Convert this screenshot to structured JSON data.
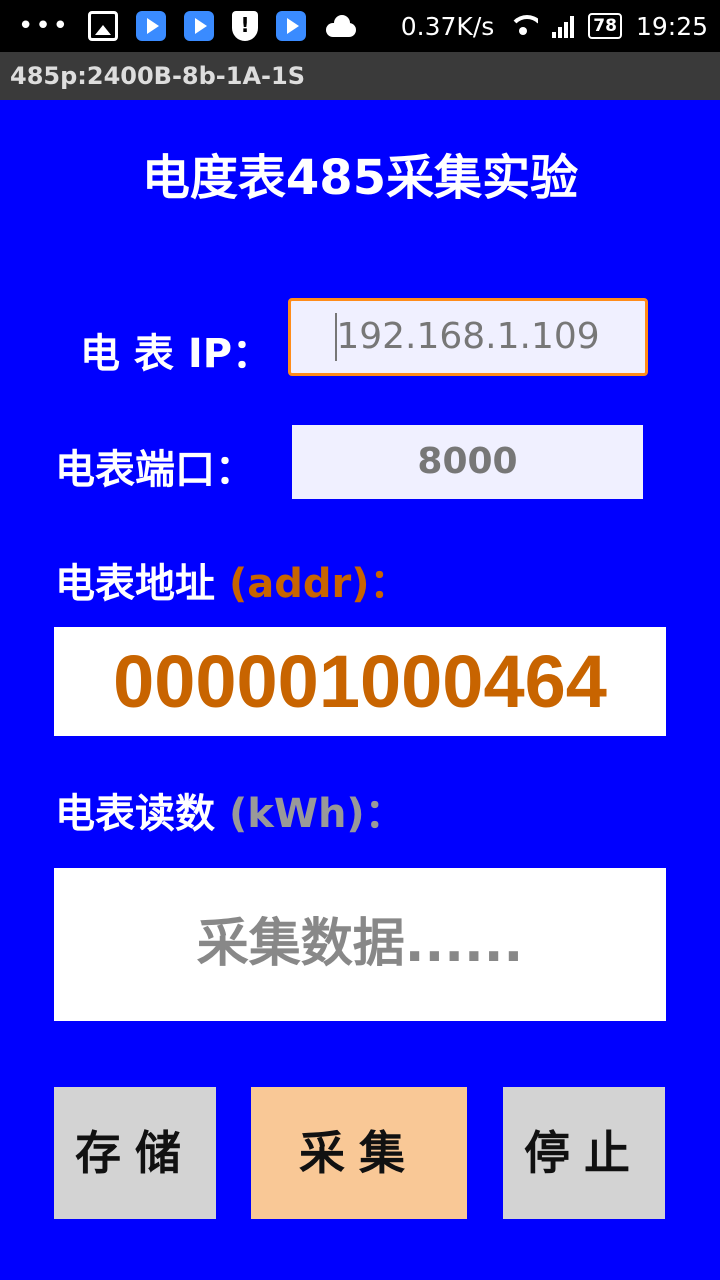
{
  "statusbar": {
    "dots": "•••",
    "net_speed": "0.37K/s",
    "battery": "78",
    "time": "19:25"
  },
  "window": {
    "title": "485p:2400B-8b-1A-1S"
  },
  "page": {
    "title": "电度表485采集实验"
  },
  "form": {
    "ip_label": "电 表 IP：",
    "ip_value": "192.168.1.109",
    "port_label": "电表端口：",
    "port_value": "8000",
    "addr_label": "电表地址",
    "addr_unit": "(addr)：",
    "addr_value": "000001000464",
    "reading_label": "电表读数",
    "reading_unit": "(kWh)：",
    "reading_value": "采集数据......"
  },
  "buttons": {
    "save": "存储",
    "collect": "采集",
    "stop": "停止"
  },
  "colors": {
    "background": "#0000ff",
    "accent_orange": "#c86400",
    "collect_button": "#f9c896",
    "input_border_focus": "#ff8c1a"
  }
}
